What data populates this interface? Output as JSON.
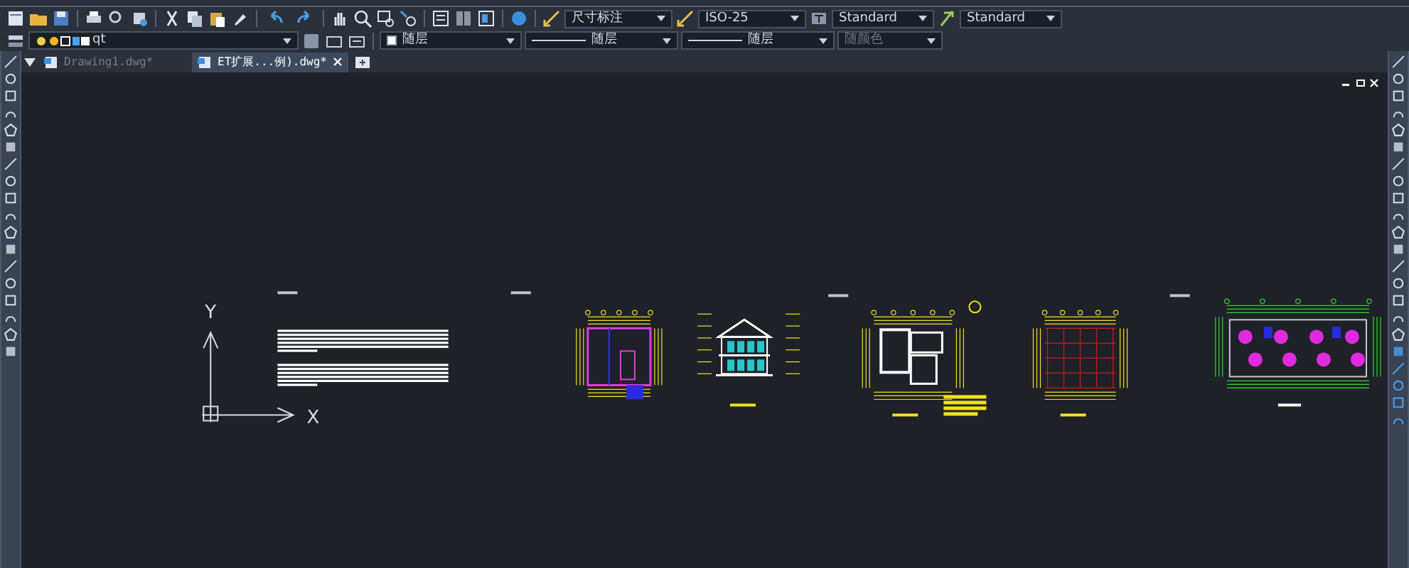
{
  "toolbar": {
    "dropdowns": [
      {
        "kind": "dimstyle",
        "value": "尺寸标注"
      },
      {
        "kind": "dimstyle",
        "value": "ISO-25"
      },
      {
        "kind": "textstyle",
        "value": "Standard"
      },
      {
        "kind": "tablestyle",
        "value": "Standard"
      }
    ]
  },
  "layer_bar": {
    "layer": {
      "value": "qt"
    },
    "properties": [
      {
        "kind": "color",
        "value": "随层",
        "disabled": false
      },
      {
        "kind": "linetype",
        "value": "随层",
        "disabled": false
      },
      {
        "kind": "lineweight",
        "value": "随层",
        "disabled": false
      },
      {
        "kind": "plotstyle",
        "value": "随颜色",
        "disabled": true
      }
    ]
  },
  "tabs": [
    {
      "label": "Drawing1.dwg*",
      "selected": false
    },
    {
      "label": "ET扩展...例).dwg*",
      "selected": true
    }
  ],
  "canvas": {
    "ucs": {
      "y_label": "Y",
      "x_label": "X"
    }
  }
}
